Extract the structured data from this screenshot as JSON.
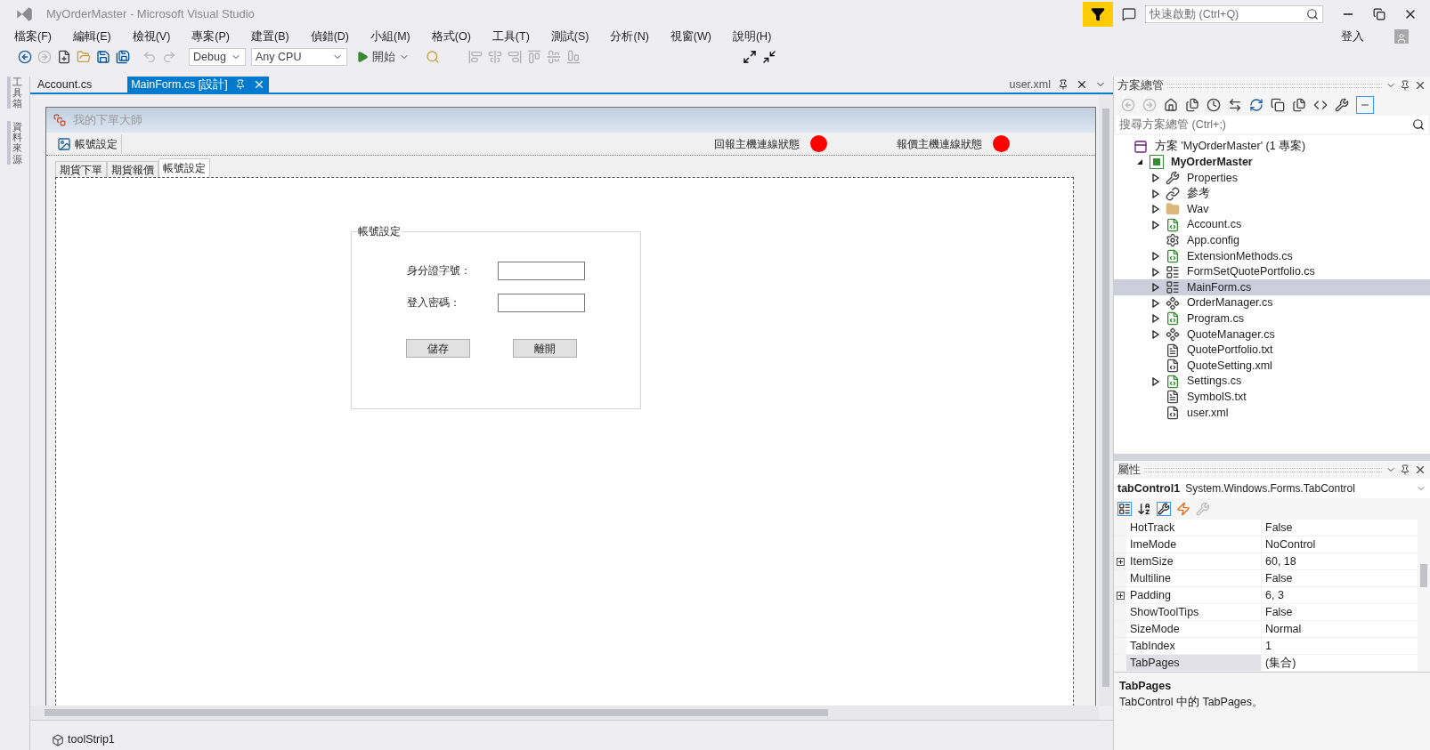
{
  "window": {
    "title": "MyOrderMaster - Microsoft Visual Studio",
    "quick_launch": {
      "placeholder": "快速啟動 (Ctrl+Q)"
    },
    "sign_in": "登入"
  },
  "menu": [
    "檔案(F)",
    "編輯(E)",
    "檢視(V)",
    "專案(P)",
    "建置(B)",
    "偵錯(D)",
    "小組(M)",
    "格式(O)",
    "工具(T)",
    "測試(S)",
    "分析(N)",
    "視窗(W)",
    "說明(H)"
  ],
  "toolbar": {
    "configuration": "Debug",
    "platform": "Any CPU",
    "start": "開始"
  },
  "side_tabs": [
    "工具箱",
    "資料來源"
  ],
  "document_tabs": [
    {
      "label": "Account.cs",
      "selected": false
    },
    {
      "label": "MainForm.cs [設計]",
      "selected": true
    }
  ],
  "preview_tab": "user.xml",
  "form": {
    "title": "我的下單大師",
    "toolstrip_button": "帳號設定",
    "statuses": [
      {
        "label": "回報主機連線狀態",
        "color": "#ff0000"
      },
      {
        "label": "報價主機連線狀態",
        "color": "#ff0000"
      }
    ],
    "tabs": [
      {
        "label": "期貨下單",
        "selected": false
      },
      {
        "label": "期貨報價",
        "selected": false
      },
      {
        "label": "帳號設定",
        "selected": true
      }
    ],
    "group": {
      "title": "帳號設定",
      "fields": [
        {
          "label": "身分證字號："
        },
        {
          "label": "登入密碼："
        }
      ],
      "buttons": [
        "儲存",
        "離開"
      ]
    }
  },
  "component_tray": [
    "toolStrip1"
  ],
  "solution_explorer": {
    "title": "方案總管",
    "search": {
      "placeholder": "搜尋方案總管 (Ctrl+;)"
    },
    "tree": [
      {
        "label": "方案 'MyOrderMaster' (1 專案)",
        "kind": "solution",
        "selected": false,
        "children": [
          {
            "label": "MyOrderMaster",
            "kind": "project",
            "selected": false,
            "expanded": true,
            "children": [
              {
                "label": "Properties",
                "kind": "wrench",
                "selected": false,
                "expanded": false
              },
              {
                "label": "參考",
                "kind": "references",
                "selected": false,
                "expanded": false
              },
              {
                "label": "Wav",
                "kind": "folder",
                "selected": false,
                "expanded": false
              },
              {
                "label": "Account.cs",
                "kind": "csharp",
                "selected": false,
                "expanded": false
              },
              {
                "label": "App.config",
                "kind": "config",
                "selected": false
              },
              {
                "label": "ExtensionMethods.cs",
                "kind": "csharp",
                "selected": false,
                "expanded": false
              },
              {
                "label": "FormSetQuotePortfolio.cs",
                "kind": "form",
                "selected": false,
                "expanded": false
              },
              {
                "label": "MainForm.cs",
                "kind": "form",
                "selected": true,
                "expanded": false
              },
              {
                "label": "OrderManager.cs",
                "kind": "component",
                "selected": false,
                "expanded": false
              },
              {
                "label": "Program.cs",
                "kind": "csharp",
                "selected": false,
                "expanded": false
              },
              {
                "label": "QuoteManager.cs",
                "kind": "component",
                "selected": false,
                "expanded": false
              },
              {
                "label": "QuotePortfolio.txt",
                "kind": "text",
                "selected": false
              },
              {
                "label": "QuoteSetting.xml",
                "kind": "xml",
                "selected": false
              },
              {
                "label": "Settings.cs",
                "kind": "csharp",
                "selected": false,
                "expanded": false
              },
              {
                "label": "SymbolS.txt",
                "kind": "text",
                "selected": false
              },
              {
                "label": "user.xml",
                "kind": "xml",
                "selected": false
              }
            ]
          }
        ]
      }
    ]
  },
  "properties": {
    "title": "屬性",
    "object_name": "tabControl1",
    "object_type": "System.Windows.Forms.TabControl",
    "rows": [
      {
        "name": "HotTrack",
        "value": "False",
        "selected": false
      },
      {
        "name": "ImeMode",
        "value": "NoControl",
        "selected": false
      },
      {
        "name": "ItemSize",
        "value": "60, 18",
        "selected": false,
        "expanded": false
      },
      {
        "name": "Multiline",
        "value": "False",
        "selected": false
      },
      {
        "name": "Padding",
        "value": "6, 3",
        "selected": false,
        "expanded": false
      },
      {
        "name": "ShowToolTips",
        "value": "False",
        "selected": false
      },
      {
        "name": "SizeMode",
        "value": "Normal",
        "selected": false
      },
      {
        "name": "TabIndex",
        "value": "1",
        "selected": false
      },
      {
        "name": "TabPages",
        "value": "(集合)",
        "selected": true
      }
    ],
    "description": {
      "title": "TabPages",
      "text": "TabControl 中的 TabPages。"
    }
  }
}
